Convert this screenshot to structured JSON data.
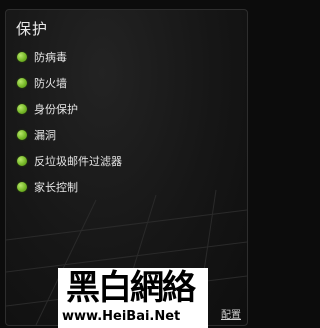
{
  "panel": {
    "title": "保护",
    "items": [
      {
        "label": "防病毒",
        "status": "on",
        "status_color": "#76b828"
      },
      {
        "label": "防火墙",
        "status": "on",
        "status_color": "#76b828"
      },
      {
        "label": "身份保护",
        "status": "on",
        "status_color": "#76b828"
      },
      {
        "label": "漏洞",
        "status": "on",
        "status_color": "#76b828"
      },
      {
        "label": "反垃圾邮件过滤器",
        "status": "on",
        "status_color": "#76b828"
      },
      {
        "label": "家长控制",
        "status": "on",
        "status_color": "#76b828"
      }
    ],
    "settings_link": "配置"
  },
  "watermark": {
    "title": "黑白網絡",
    "url": "www.HeiBai.Net"
  }
}
